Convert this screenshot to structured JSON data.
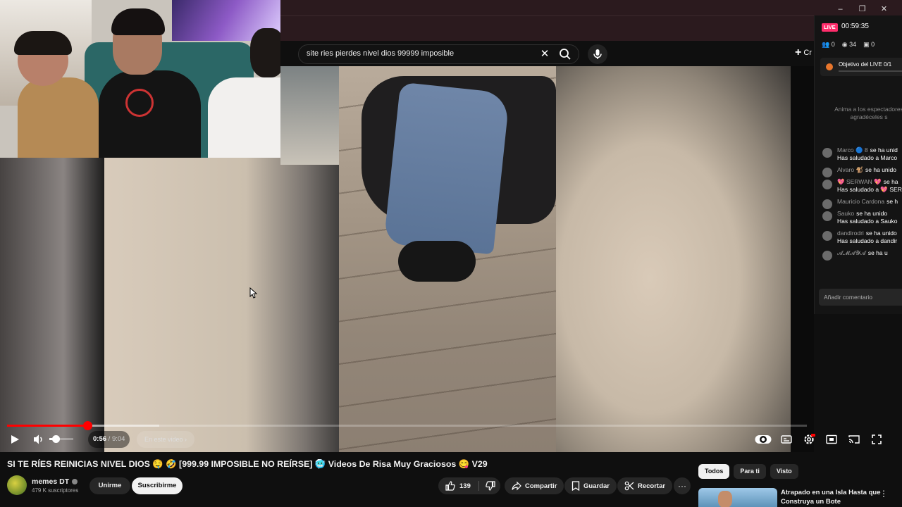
{
  "search": {
    "query": "site ries pierdes nivel dios 99999 imposible"
  },
  "header": {
    "create_label": "Cr"
  },
  "player": {
    "progress_fraction": 0.1,
    "buffer_fraction": 0.19,
    "volume_fraction": 0.25,
    "current_time": "0:56",
    "duration": "9:04",
    "chapter_label": "En este video"
  },
  "live": {
    "badge": "LIVE",
    "timer": "00:59:35",
    "stats": {
      "guests": "0",
      "viewers": "34",
      "gifts": "0"
    },
    "goal_label": "Objetivo del LIVE 0/1",
    "prompt": "Anima a los espectadores agradéceles s",
    "chat": [
      {
        "name": "Marco 🔵 8",
        "action": "se ha unid",
        "sub": "Has saludado a Marco"
      },
      {
        "name": "Alvaro 🐒",
        "action": "se ha unido",
        "sub": ""
      },
      {
        "name": "💖 SERWAN 💖",
        "action": "se ha",
        "sub": "Has saludado a 💖 SER"
      },
      {
        "name": "Mauricio Cardona",
        "action": "se h",
        "sub": ""
      },
      {
        "name": "Sauko",
        "action": "se ha unido",
        "sub": "Has saludado a Sauko"
      },
      {
        "name": "dandirodri",
        "action": "se ha unido",
        "sub": "Has saludado a dandir"
      },
      {
        "name": "𝓐𝓜𝓐𝓨𝓐",
        "action": "se ha u",
        "sub": ""
      }
    ],
    "comment_placeholder": "Añadir comentario"
  },
  "video": {
    "title": "SI TE RÍES REINICIAS NIVEL DIOS 🤤 🤣 [999.99 IMPOSIBLE NO REÍRSE] 🥶 Videos De Risa Muy Graciosos 😋 V29",
    "channel_name": "memes DT",
    "subscribers": "479 K suscriptores",
    "join_label": "Unirme",
    "subscribe_label": "Suscribirme",
    "likes": "139",
    "share_label": "Compartir",
    "save_label": "Guardar",
    "clip_label": "Recortar"
  },
  "sidebar": {
    "chips": [
      "Todos",
      "Para ti",
      "Visto"
    ],
    "recommendation_title": "Atrapado en una Isla Hasta que Construya un Bote"
  },
  "colors": {
    "accent": "#ff0000",
    "live": "#ff2d6b",
    "background": "#0f0f0f"
  }
}
